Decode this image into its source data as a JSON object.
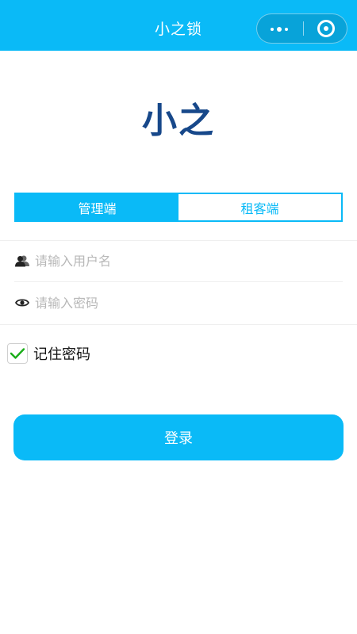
{
  "navbar": {
    "title": "小之锁",
    "menu_icon": "more-dots-icon",
    "close_icon": "target-close-icon",
    "bg_color": "#0abaf7"
  },
  "logo": {
    "text": "小之",
    "color": "#17488a"
  },
  "tabs": [
    {
      "label": "管理端",
      "active": true
    },
    {
      "label": "租客端",
      "active": false
    }
  ],
  "form": {
    "username": {
      "value": "",
      "placeholder": "请输入用户名",
      "icon": "user-icon"
    },
    "password": {
      "value": "",
      "placeholder": "请输入密码",
      "icon": "eye-icon"
    },
    "remember": {
      "label": "记住密码",
      "checked": true,
      "check_color": "#1aad19"
    }
  },
  "login_button": {
    "label": "登录",
    "color": "#0abaf7"
  }
}
